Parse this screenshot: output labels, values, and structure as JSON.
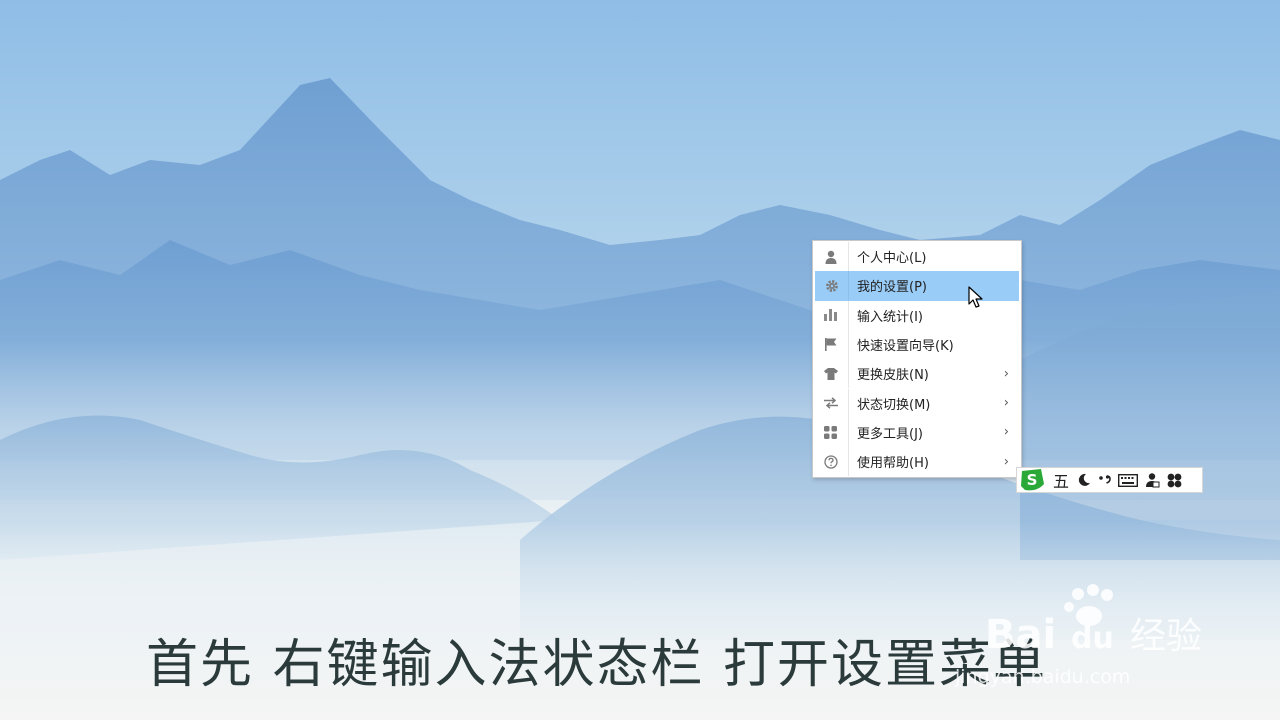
{
  "context_menu": {
    "items": [
      {
        "label": "个人中心(L)",
        "icon": "user-icon",
        "has_submenu": false
      },
      {
        "label": "我的设置(P)",
        "icon": "gear-icon",
        "has_submenu": false,
        "highlighted": true
      },
      {
        "label": "输入统计(I)",
        "icon": "bar-chart-icon",
        "has_submenu": false
      },
      {
        "label": "快速设置向导(K)",
        "icon": "flag-icon",
        "has_submenu": false
      },
      {
        "label": "更换皮肤(N)",
        "icon": "shirt-icon",
        "has_submenu": true
      },
      {
        "label": "状态切换(M)",
        "icon": "swap-arrows-icon",
        "has_submenu": true
      },
      {
        "label": "更多工具(J)",
        "icon": "grid-icon",
        "has_submenu": true
      },
      {
        "label": "使用帮助(H)",
        "icon": "help-icon",
        "has_submenu": true
      }
    ],
    "submenu_arrow": "›",
    "highlight_color": "#99ccf7"
  },
  "ime_status_bar": {
    "mode_label": "五",
    "icons": [
      "sogou-logo-icon",
      "moon-icon",
      "punctuation-icon",
      "keyboard-icon",
      "skin-icon",
      "toolbox-icon"
    ],
    "logo_color": "#2aa838"
  },
  "subtitle": "首先  右键输入法状态栏  打开设置菜单",
  "watermark": {
    "brand": "Bai",
    "brand_paw": "du",
    "cn": "经验",
    "url": "jingyan.baidu.com"
  }
}
